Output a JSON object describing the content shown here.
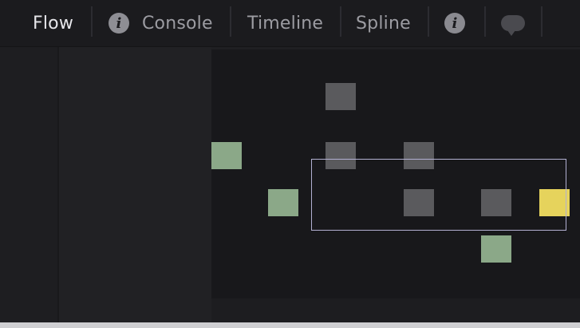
{
  "tabs": [
    {
      "label": "Flow",
      "active": true
    },
    {
      "label": "Console",
      "icon": "info-icon"
    },
    {
      "label": "Timeline"
    },
    {
      "label": "Spline"
    }
  ],
  "extra_icons": [
    "info-icon",
    "speech-bubble-icon"
  ],
  "info_glyph": "i",
  "colors": {
    "node_gray": "#5a5a5d",
    "node_green": "#8ba888",
    "node_yellow": "#e6d35c",
    "selection_border": "#b2b0d2"
  }
}
